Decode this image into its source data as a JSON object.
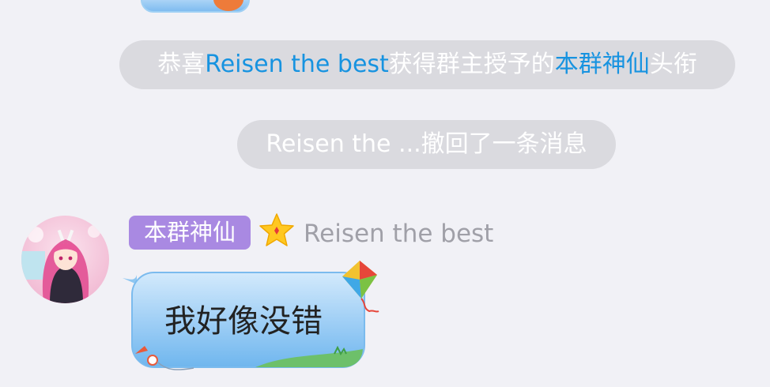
{
  "system_messages": [
    {
      "segments": [
        {
          "text": "恭喜",
          "highlight": false
        },
        {
          "text": "Reisen the best",
          "highlight": true
        },
        {
          "text": "获得群主授予的",
          "highlight": false
        },
        {
          "text": "本群神仙",
          "highlight": true
        },
        {
          "text": "头衔",
          "highlight": false
        }
      ]
    },
    {
      "segments": [
        {
          "text": "Reisen the ...撤回了一条消息",
          "highlight": false
        }
      ]
    }
  ],
  "message": {
    "title_badge": "本群神仙",
    "username": "Reisen the best",
    "text": "我好像没错",
    "level_icon": "star-icon"
  },
  "colors": {
    "background": "#f1f1f6",
    "pill_background": "#dadadf",
    "highlight": "#1793e0",
    "title_badge": "#a989e2",
    "username": "#a0a0a8",
    "bubble_top": "#d3eafc",
    "bubble_bottom": "#6fb6ee"
  }
}
